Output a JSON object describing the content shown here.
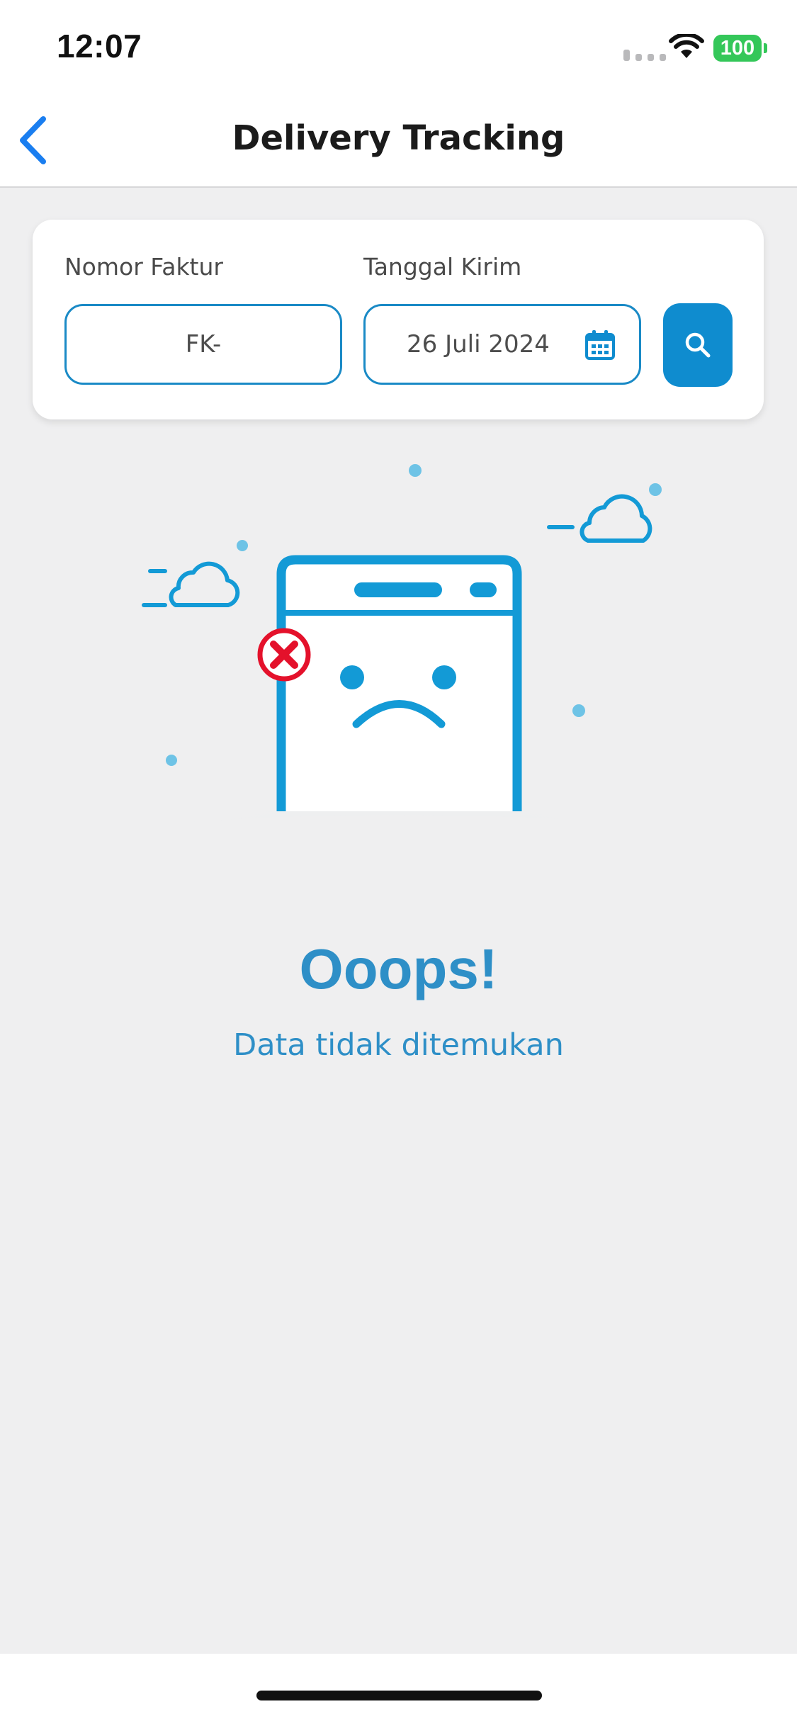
{
  "status_bar": {
    "time": "12:07",
    "battery": "100",
    "battery_color": "#34c759",
    "icons": [
      "cellular-signal-icon",
      "wifi-icon",
      "battery-icon"
    ]
  },
  "header": {
    "title": "Delivery Tracking",
    "back_icon": "chevron-left-icon",
    "accent_color": "#1a7ef0"
  },
  "filter": {
    "invoice_label": "Nomor Faktur",
    "invoice_value": "FK-",
    "date_label": "Tanggal Kirim",
    "date_value": "26 Juli 2024",
    "calendar_icon": "calendar-icon",
    "search_icon": "search-icon",
    "brand_color": "#0f8ccf"
  },
  "empty_state": {
    "title": "Ooops!",
    "message": "Data tidak ditemukan",
    "illustration": "sad-phone-illustration",
    "error_icon": "error-x-icon",
    "text_color": "#2e8fc7"
  }
}
